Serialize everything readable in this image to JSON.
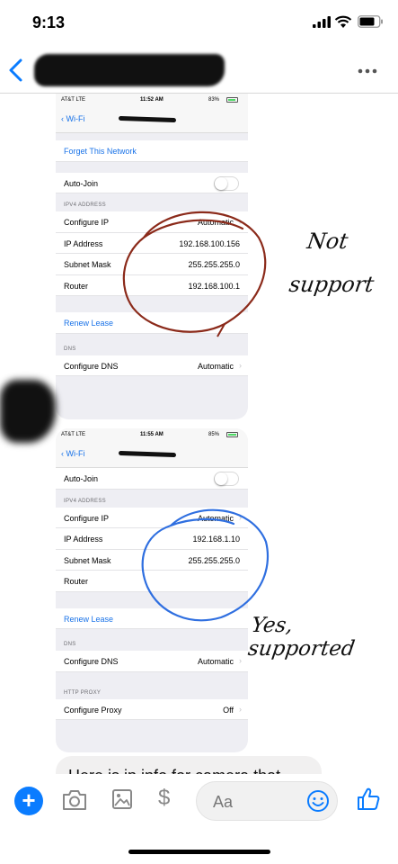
{
  "status_bar": {
    "time": "9:13"
  },
  "screenshot1": {
    "status": {
      "carrier": "AT&T LTE",
      "time": "11:52 AM",
      "battery": "83%"
    },
    "nav": {
      "back": "Wi-Fi"
    },
    "forget": "Forget This Network",
    "auto_join": "Auto-Join",
    "ipv4_header": "IPV4 ADDRESS",
    "rows": [
      {
        "label": "Configure IP",
        "value": "Automatic"
      },
      {
        "label": "IP Address",
        "value": "192.168.100.156"
      },
      {
        "label": "Subnet Mask",
        "value": "255.255.255.0"
      },
      {
        "label": "Router",
        "value": "192.168.100.1"
      }
    ],
    "renew": "Renew Lease",
    "dns_header": "DNS",
    "configure_dns": {
      "label": "Configure DNS",
      "value": "Automatic"
    }
  },
  "screenshot2": {
    "status": {
      "carrier": "AT&T LTE",
      "time": "11:55 AM",
      "battery": "85%"
    },
    "nav": {
      "back": "Wi-Fi"
    },
    "auto_join": "Auto-Join",
    "ipv4_header": "IPV4 ADDRESS",
    "rows": [
      {
        "label": "Configure IP",
        "value": "Automatic"
      },
      {
        "label": "IP Address",
        "value": "192.168.1.10"
      },
      {
        "label": "Subnet Mask",
        "value": "255.255.255.0"
      },
      {
        "label": "Router",
        "value": ""
      }
    ],
    "renew": "Renew Lease",
    "dns_header": "DNS",
    "configure_dns": {
      "label": "Configure DNS",
      "value": "Automatic"
    },
    "proxy_header": "HTTP PROXY",
    "configure_proxy": {
      "label": "Configure Proxy",
      "value": "Off"
    }
  },
  "annotations": {
    "not_line1": "Not",
    "not_line2": "support",
    "yes": "Yes, supported"
  },
  "next_message": "Here is ip info for camera that",
  "composer": {
    "placeholder": "Aa",
    "dollar": "$"
  },
  "colors": {
    "accent": "#0a7cff",
    "link": "#1a73e8",
    "red_circle": "#8b2a1a",
    "blue_circle": "#2f6fe0"
  },
  "icons": [
    "back-chevron-icon",
    "more-icon",
    "camera-icon",
    "image-icon",
    "dollar-icon",
    "emoji-icon",
    "like-icon",
    "plus-icon"
  ]
}
